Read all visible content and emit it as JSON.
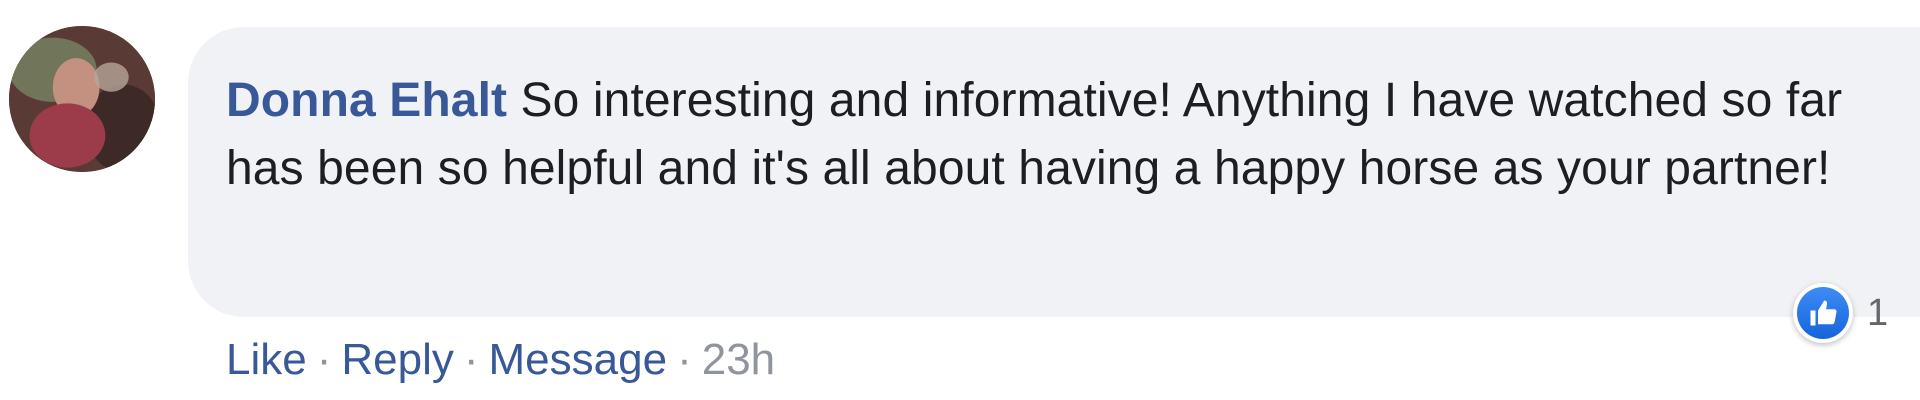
{
  "comment": {
    "author": "Donna Ehalt",
    "text": "So interesting and informative! Anything I have watched so far has been so helpful and it's all about having a happy horse as your partner!",
    "reaction_icon": "like-icon",
    "reaction_count": "1"
  },
  "actions": {
    "like_label": "Like",
    "reply_label": "Reply",
    "message_label": "Message",
    "separator": "·",
    "timestamp": "23h"
  },
  "colors": {
    "author_link": "#385898",
    "bubble_bg": "#f0f2f5",
    "like_blue": "#1877f2",
    "meta_gray": "#90949c"
  }
}
